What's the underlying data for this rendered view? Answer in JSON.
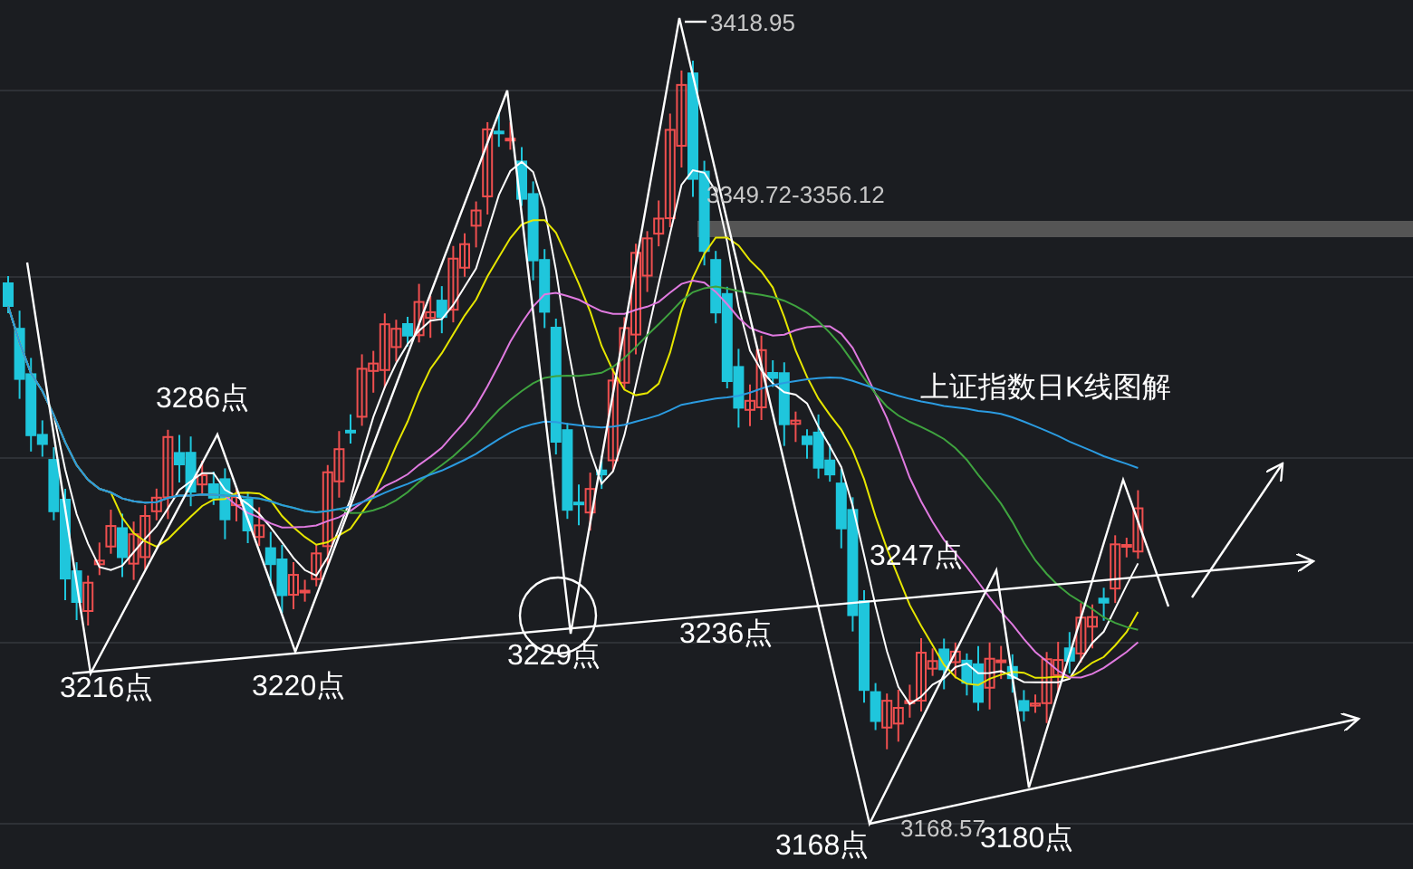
{
  "chart": {
    "title": "上证指数日K线图解",
    "high_label": "3418.95",
    "range_label": "3349.72-3356.12",
    "low_label": "3168.57",
    "points": [
      {
        "label": "3286点"
      },
      {
        "label": "3247点"
      },
      {
        "label": "3216点"
      },
      {
        "label": "3220点"
      },
      {
        "label": "3229点"
      },
      {
        "label": "3236点"
      },
      {
        "label": "3168点"
      },
      {
        "label": "3180点"
      }
    ]
  }
}
